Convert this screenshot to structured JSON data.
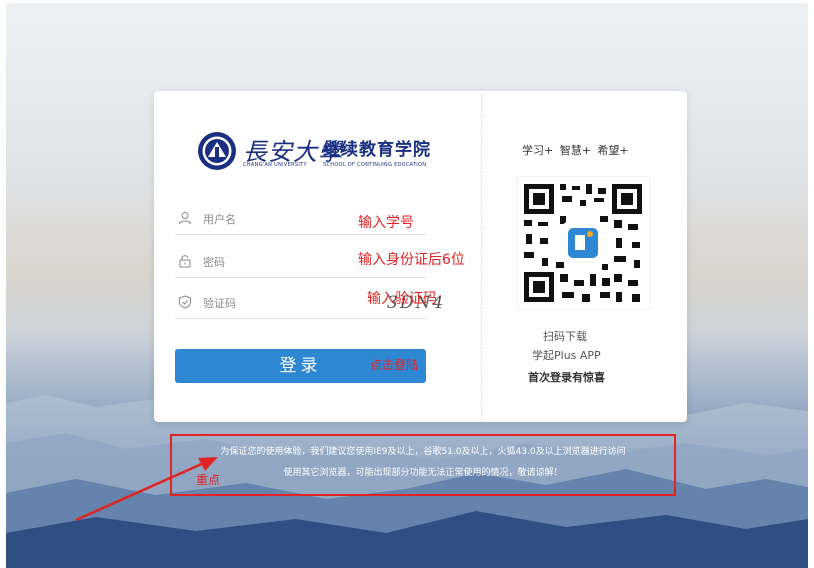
{
  "logo": {
    "cursive": "長安大學",
    "en_university": "CHANG'AN UNIVERSITY",
    "college": "继续教育学院",
    "en_college": "SCHOOL OF CONTINUING EDUCATION"
  },
  "form": {
    "username_placeholder": "用户名",
    "password_placeholder": "密码",
    "captcha_placeholder": "验证码",
    "captcha_text": "3DN4",
    "login_label": "登录"
  },
  "side": {
    "slogan": "学习+ 智慧+ 希望+",
    "scan_text": "扫码下载",
    "app_name": "学起Plus APP",
    "first_login": "首次登录有惊喜"
  },
  "notice": {
    "line1": "为保证您的使用体验，我们建议您使用IE9及以上，谷歌51.0及以上，火狐43.0及以上浏览器进行访问",
    "line2": "使用其它浏览器，可能出现部分功能无法正常使用的情况，敬请谅解！"
  },
  "annotations": {
    "username_hint": "输入学号",
    "password_hint": "输入身份证后6位",
    "captcha_hint": "输入验证码",
    "login_hint": "点击登陆",
    "notice_hint": "重点"
  },
  "colors": {
    "primary_button": "#2e87d3",
    "brand_blue": "#1a2f82",
    "annotation_red": "#e02424"
  }
}
